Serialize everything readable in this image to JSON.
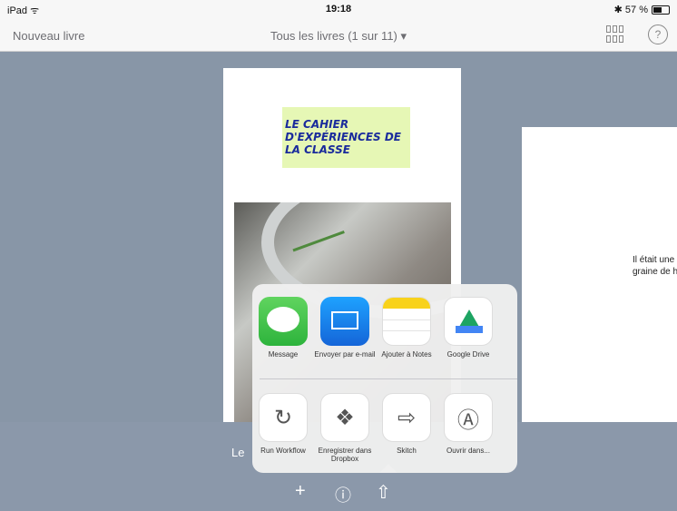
{
  "status_bar": {
    "device": "iPad ᯤ",
    "time": "19:18",
    "battery_text": "✱ 57 %"
  },
  "nav": {
    "left_label": "Nouveau livre",
    "title": "Tous les livres (1 sur 11) ▾",
    "help_symbol": "?"
  },
  "book_main": {
    "title": "LE CAHIER D'EXPÉRIENCES DE LA CLASSE",
    "caption": "Le"
  },
  "book_right": {
    "text_line1": "Il était une",
    "text_line2": "graine de h"
  },
  "toolbar": {
    "add_symbol": "+",
    "info_symbol": "ⓘ",
    "share_symbol": "⇧"
  },
  "share_sheet": {
    "top_row": [
      {
        "label": "Message",
        "icon": "message-icon"
      },
      {
        "label": "Envoyer par e-mail",
        "icon": "mail-icon"
      },
      {
        "label": "Ajouter à Notes",
        "icon": "notes-icon"
      },
      {
        "label": "Google Drive",
        "icon": "google-drive-icon"
      }
    ],
    "bottom_row": [
      {
        "label": "Run Workflow",
        "icon": "refresh-icon",
        "glyph": "↻"
      },
      {
        "label": "Enregistrer dans Dropbox",
        "icon": "dropbox-icon",
        "glyph": "❖"
      },
      {
        "label": "Skitch",
        "icon": "skitch-icon",
        "glyph": "⇨"
      },
      {
        "label": "Ouvrir dans...",
        "icon": "app-store-icon",
        "glyph": "Ⓐ"
      }
    ]
  }
}
